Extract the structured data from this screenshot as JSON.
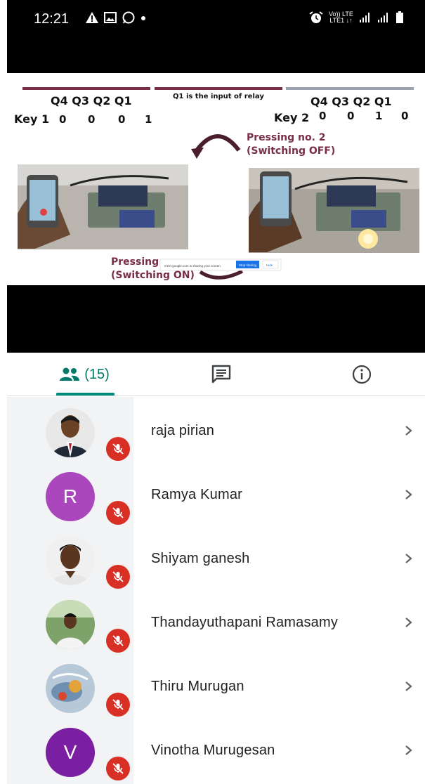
{
  "status_bar": {
    "time": "12:21",
    "left_icons": [
      "warning-icon",
      "image-icon",
      "whatsapp-icon",
      "dot-icon"
    ],
    "right_icons": [
      "alarm-icon",
      "volte-lte-icon",
      "signal-icon",
      "signal-icon",
      "battery-icon"
    ],
    "volte_top": "Vo)) LTE",
    "volte_bottom": "LTE1 ↓↑"
  },
  "slide": {
    "left_header": "Q4  Q3  Q2  Q1",
    "key1_label": "Key 1",
    "key1_values": [
      "0",
      "0",
      "0",
      "1"
    ],
    "note": "Q1 is the input of relay",
    "right_header": "Q4  Q3  Q2  Q1",
    "key2_label": "Key 2",
    "key2_values": [
      "0",
      "0",
      "1",
      "0"
    ],
    "pressing_off_line1": "Pressing no. 2",
    "pressing_off_line2": "(Switching OFF)",
    "pressing_on_line1": "Pressing",
    "pressing_on_line2": "(Switching ON)",
    "share_banner_text": "meet.google.com is sharing your screen.",
    "share_stop": "Stop sharing",
    "share_hide": "Hide"
  },
  "tabs": {
    "people_count": "(15)",
    "people_icon": "people-icon",
    "chat_icon": "chat-icon",
    "info_icon": "info-icon",
    "accent": "#00796b"
  },
  "participants": [
    {
      "name": "raja pirian",
      "avatar": "photo"
    },
    {
      "name": "Ramya Kumar",
      "avatar": "letter",
      "letter": "R",
      "color": "#ab47bc"
    },
    {
      "name": "Shiyam ganesh",
      "avatar": "photo"
    },
    {
      "name": "Thandayuthapani Ramasamy",
      "avatar": "photo"
    },
    {
      "name": "Thiru Murugan",
      "avatar": "photo"
    },
    {
      "name": "Vinotha Murugesan",
      "avatar": "letter",
      "letter": "V",
      "color": "#7b1fa2"
    }
  ],
  "colors": {
    "mute_red": "#d93025",
    "slide_maroon": "#7a2e46",
    "slide_gray": "#9aa3ad"
  }
}
